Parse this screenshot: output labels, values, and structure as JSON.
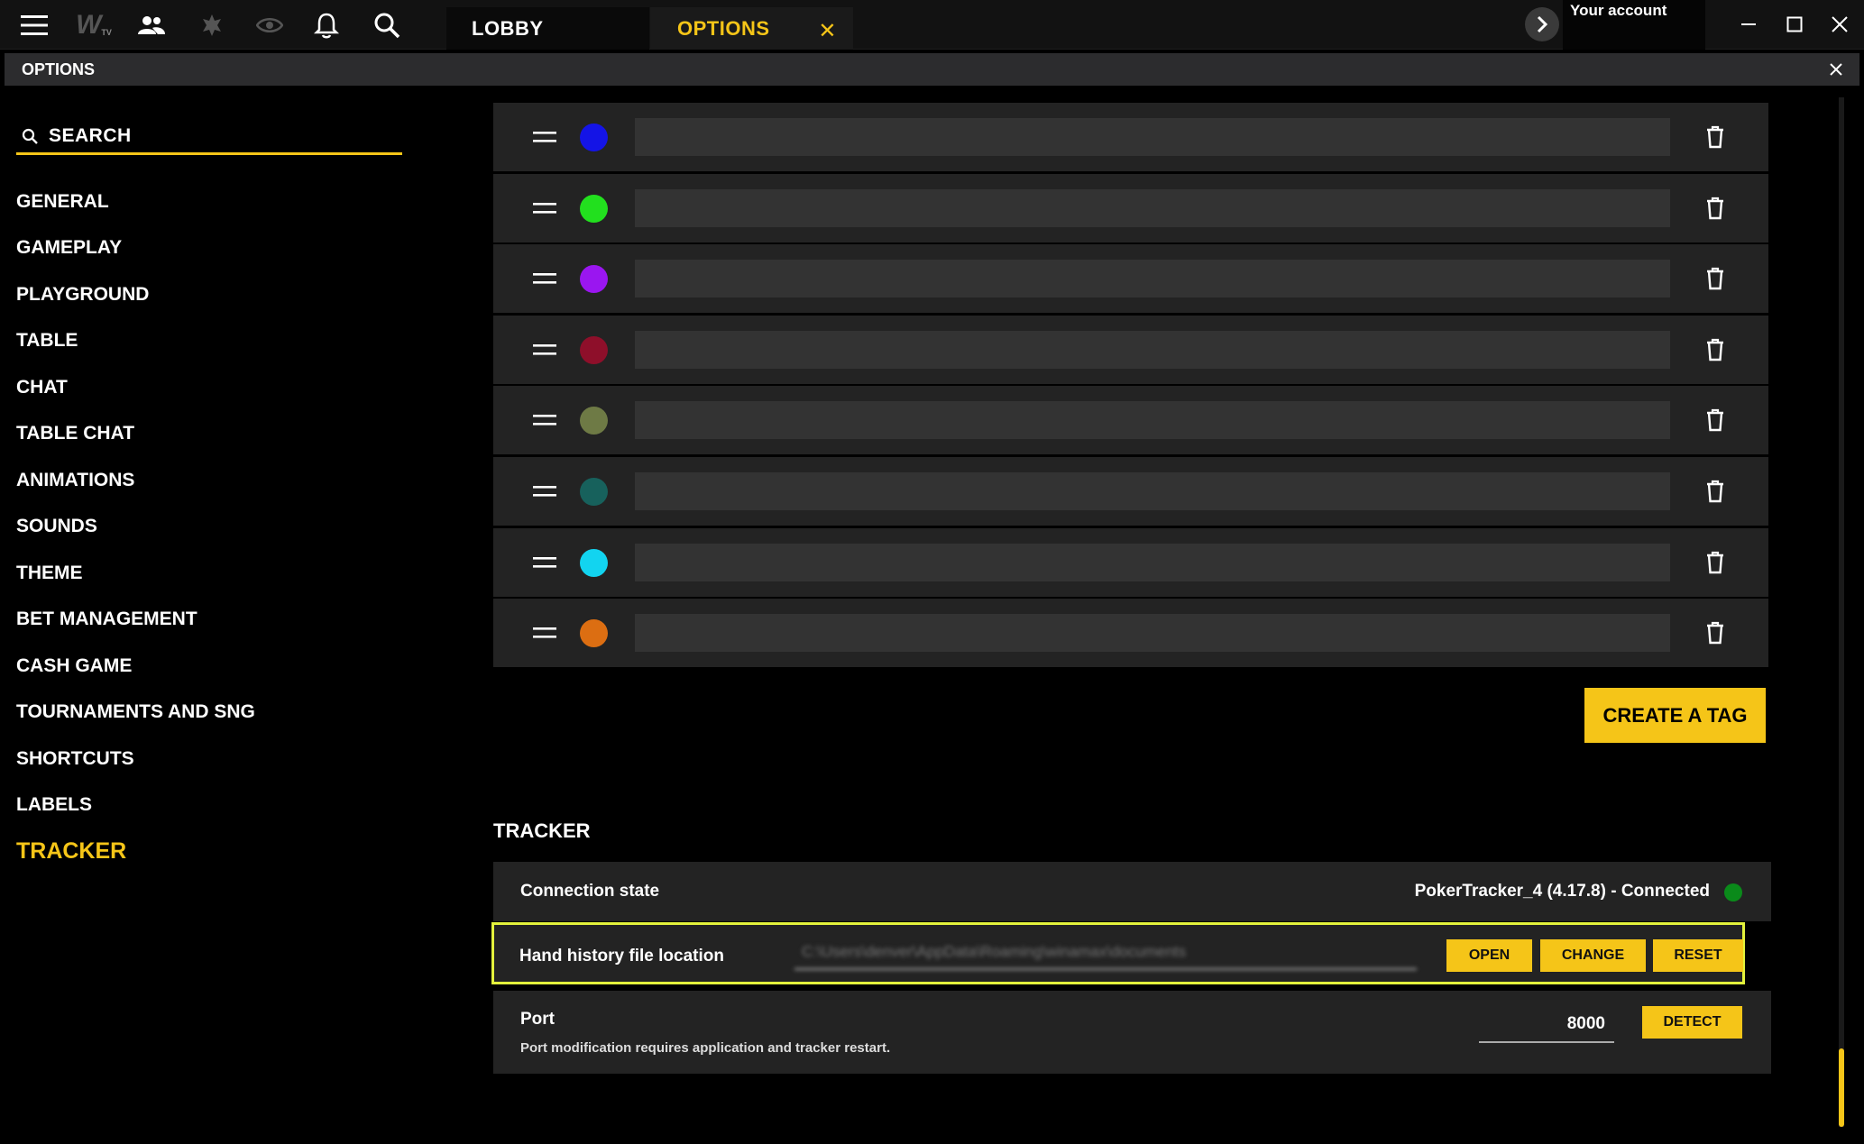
{
  "colors": {
    "accent": "#f5c518",
    "highlight": "#e3f23c",
    "connected": "#0a8a1a"
  },
  "topbar": {
    "icons": [
      "menu-icon",
      "winamax-tv-logo",
      "friends-icon",
      "poker-icon",
      "eye-icon",
      "bell-icon",
      "search-icon"
    ],
    "logo_text": "W",
    "logo_sub": "TV",
    "tabs": [
      {
        "label": "LOBBY"
      },
      {
        "label": "OPTIONS",
        "close": "✕"
      }
    ],
    "account_label": "Your account"
  },
  "options_header": {
    "title": "OPTIONS"
  },
  "sidebar": {
    "search_label": "SEARCH",
    "items": [
      {
        "label": "GENERAL"
      },
      {
        "label": "GAMEPLAY"
      },
      {
        "label": "PLAYGROUND"
      },
      {
        "label": "TABLE"
      },
      {
        "label": "CHAT"
      },
      {
        "label": "TABLE CHAT"
      },
      {
        "label": "ANIMATIONS"
      },
      {
        "label": "SOUNDS"
      },
      {
        "label": "THEME"
      },
      {
        "label": "BET MANAGEMENT"
      },
      {
        "label": "CASH GAME"
      },
      {
        "label": "TOURNAMENTS AND SNG"
      },
      {
        "label": "SHORTCUTS"
      },
      {
        "label": "LABELS"
      },
      {
        "label": "TRACKER"
      }
    ],
    "active": "TRACKER"
  },
  "tags": [
    {
      "color": "#1414e6"
    },
    {
      "color": "#22e01e"
    },
    {
      "color": "#9a16f0"
    },
    {
      "color": "#8e0f2a"
    },
    {
      "color": "#6e7a45"
    },
    {
      "color": "#17615c"
    },
    {
      "color": "#12d4f0"
    },
    {
      "color": "#dc6e12"
    }
  ],
  "create_tag_label": "CREATE A TAG",
  "tracker": {
    "title": "TRACKER",
    "connection_label": "Connection state",
    "connection_value": "PokerTracker_4 (4.17.8) - Connected",
    "hand_history_label": "Hand history file location",
    "hand_history_path": "C:\\Users\\denver\\AppData\\Roaming\\winamax\\documents",
    "open_label": "OPEN",
    "change_label": "CHANGE",
    "reset_label": "RESET",
    "port_label": "Port",
    "port_value": "8000",
    "port_note": "Port modification requires application and tracker restart.",
    "detect_label": "DETECT"
  }
}
